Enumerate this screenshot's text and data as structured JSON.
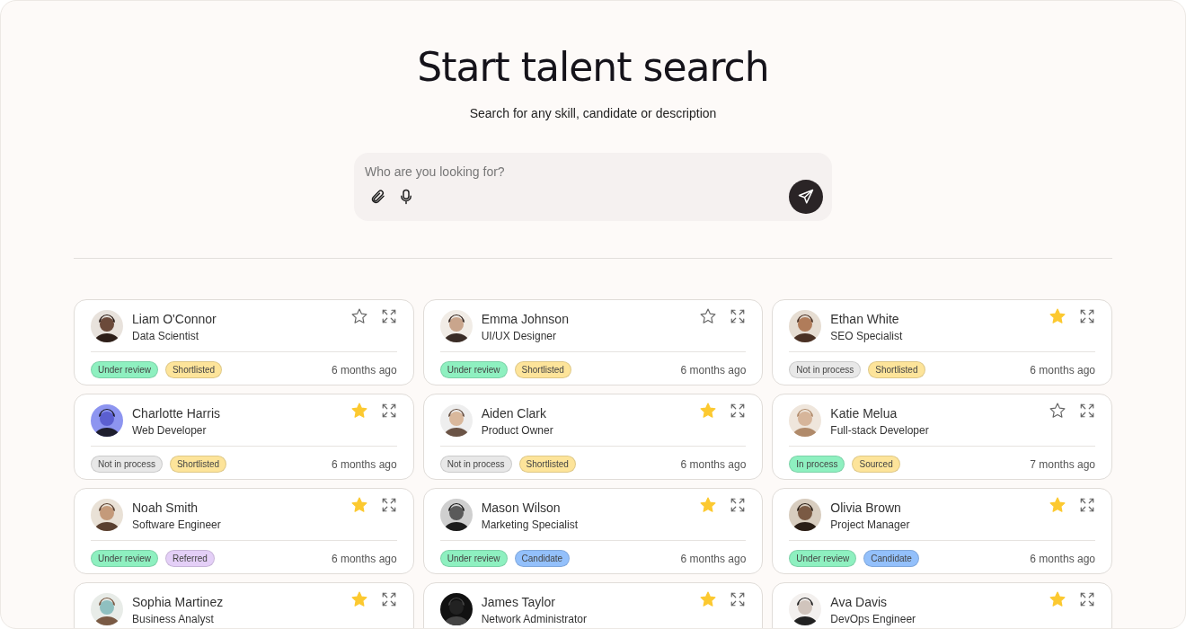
{
  "header": {
    "title": "Start talent search",
    "subtitle": "Search for any skill, candidate or description"
  },
  "search": {
    "placeholder": "Who are you looking for?"
  },
  "candidates": [
    {
      "name": "Liam O'Connor",
      "role": "Data Scientist",
      "starred": false,
      "time": "6 months ago",
      "tags": [
        {
          "label": "Under review",
          "color": "#8ef0c0"
        },
        {
          "label": "Shortlisted",
          "color": "#fde49a"
        }
      ]
    },
    {
      "name": "Emma Johnson",
      "role": "UI/UX Designer",
      "starred": false,
      "time": "6 months ago",
      "tags": [
        {
          "label": "Under review",
          "color": "#8ef0c0"
        },
        {
          "label": "Shortlisted",
          "color": "#fde49a"
        }
      ]
    },
    {
      "name": "Ethan White",
      "role": "SEO Specialist",
      "starred": true,
      "time": "6 months ago",
      "tags": [
        {
          "label": "Not in process",
          "color": "#e8e8e8"
        },
        {
          "label": "Shortlisted",
          "color": "#fde49a"
        }
      ]
    },
    {
      "name": "Charlotte Harris",
      "role": "Web Developer",
      "starred": true,
      "time": "6 months ago",
      "tags": [
        {
          "label": "Not in process",
          "color": "#e8e8e8"
        },
        {
          "label": "Shortlisted",
          "color": "#fde49a"
        }
      ]
    },
    {
      "name": "Aiden Clark",
      "role": "Product Owner",
      "starred": true,
      "time": "6 months ago",
      "tags": [
        {
          "label": "Not in process",
          "color": "#e8e8e8"
        },
        {
          "label": "Shortlisted",
          "color": "#fde49a"
        }
      ]
    },
    {
      "name": "Katie Melua",
      "role": "Full-stack Developer",
      "starred": false,
      "time": "7 months ago",
      "tags": [
        {
          "label": "In process",
          "color": "#8ef0c0"
        },
        {
          "label": "Sourced",
          "color": "#fde49a"
        }
      ]
    },
    {
      "name": "Noah Smith",
      "role": "Software Engineer",
      "starred": true,
      "time": "6 months ago",
      "tags": [
        {
          "label": "Under review",
          "color": "#8ef0c0"
        },
        {
          "label": "Referred",
          "color": "#e4cff7"
        }
      ]
    },
    {
      "name": "Mason Wilson",
      "role": "Marketing Specialist",
      "starred": true,
      "time": "6 months ago",
      "tags": [
        {
          "label": "Under review",
          "color": "#8ef0c0"
        },
        {
          "label": "Candidate",
          "color": "#93c0fb"
        }
      ]
    },
    {
      "name": "Olivia Brown",
      "role": "Project Manager",
      "starred": true,
      "time": "6 months ago",
      "tags": [
        {
          "label": "Under review",
          "color": "#8ef0c0"
        },
        {
          "label": "Candidate",
          "color": "#93c0fb"
        }
      ]
    },
    {
      "name": "Sophia Martinez",
      "role": "Business Analyst",
      "starred": true
    },
    {
      "name": "James Taylor",
      "role": "Network Administrator",
      "starred": true
    },
    {
      "name": "Ava Davis",
      "role": "DevOps Engineer",
      "starred": true
    }
  ]
}
